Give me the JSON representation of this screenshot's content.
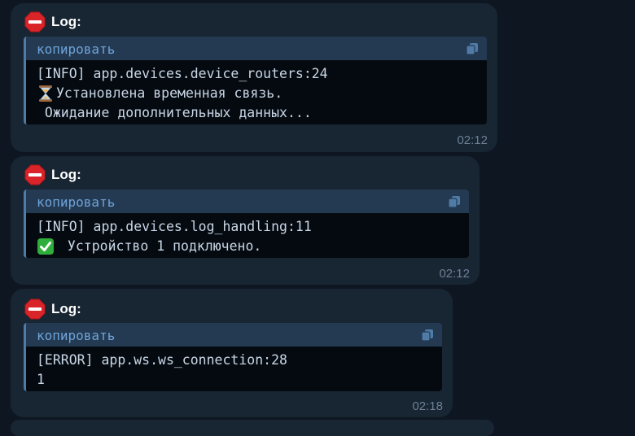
{
  "messages": [
    {
      "label": "Log:",
      "code_lang": "копировать",
      "line1": "[INFO] app.devices.device_routers:24",
      "line2": "Установлена временная связь.",
      "line3": " Ожидание дополнительных данных...",
      "time": "02:12",
      "icons": [
        "stop-sign-icon",
        "copy-icon",
        "hourglass-icon"
      ]
    },
    {
      "label": "Log:",
      "code_lang": "копировать",
      "line1": "[INFO] app.devices.log_handling:11",
      "line2": " Устройство 1 подключено.",
      "time": "02:12",
      "icons": [
        "stop-sign-icon",
        "copy-icon",
        "check-mark-icon"
      ]
    },
    {
      "label": "Log:",
      "code_lang": "копировать",
      "line1": "[ERROR] app.ws.ws_connection:28",
      "line2": "1",
      "time": "02:18",
      "icons": [
        "stop-sign-icon",
        "copy-icon"
      ]
    }
  ],
  "colors": {
    "background": "#0e1621",
    "bubble": "#182533",
    "code_header": "#243a52",
    "code_body": "#050a10",
    "accent": "#6ea3d9",
    "stop_red": "#d9252a",
    "check_green": "#2fae3b"
  }
}
